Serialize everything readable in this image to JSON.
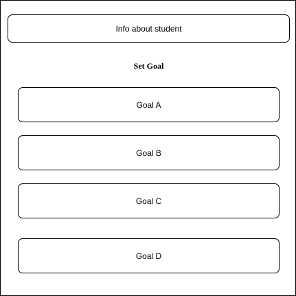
{
  "info": {
    "label": "Info about student"
  },
  "heading": "Set Goal",
  "goals": [
    {
      "label": "Goal A"
    },
    {
      "label": "Goal B"
    },
    {
      "label": "Goal C"
    },
    {
      "label": "Goal D"
    }
  ]
}
